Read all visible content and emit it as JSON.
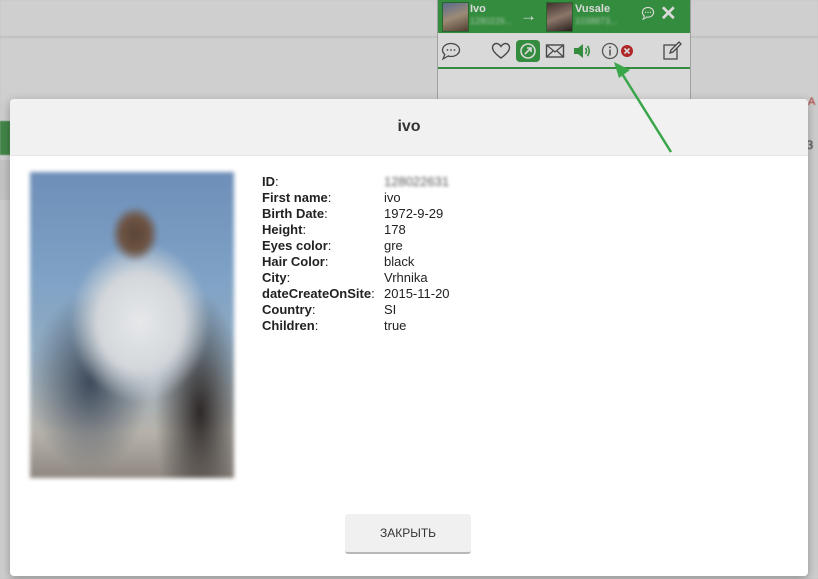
{
  "background": {
    "right_red_text": "А",
    "right_dark_text": "З"
  },
  "chat": {
    "from_name": "Ivo",
    "from_sub": "1280226...",
    "to_name": "Vusale",
    "to_sub": "1038873...",
    "arrow": "→",
    "close": "✕",
    "accent_color": "#3ea64a",
    "icons": [
      "chat-bubble-icon",
      "heart-icon",
      "gift-icon",
      "mail-icon",
      "sound-icon",
      "info-icon",
      "close-circle-icon",
      "edit-icon"
    ]
  },
  "modal": {
    "title": "ivo",
    "close_button": "ЗАКРЫТЬ",
    "fields": [
      {
        "label": "ID",
        "value": "128022631"
      },
      {
        "label": "First name",
        "value": "ivo"
      },
      {
        "label": "Birth Date",
        "value": "1972-9-29"
      },
      {
        "label": "Height",
        "value": "178"
      },
      {
        "label": "Eyes color",
        "value": "gre"
      },
      {
        "label": "Hair Color",
        "value": "black"
      },
      {
        "label": "City",
        "value": "Vrhnika"
      },
      {
        "label": "dateCreateOnSite",
        "value": "2015-11-20"
      },
      {
        "label": "Country",
        "value": "SI"
      },
      {
        "label": "Children",
        "value": "true"
      }
    ]
  },
  "annotation": {
    "arrow_color": "#3aa64a"
  }
}
